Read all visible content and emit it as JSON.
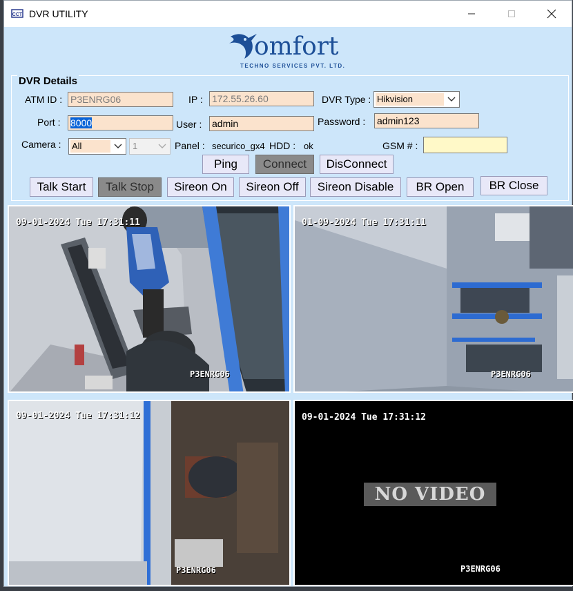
{
  "window": {
    "title": "DVR UTILITY"
  },
  "logo": {
    "word": "omfort",
    "subtitle": "TECHNO SERVICES PVT. LTD."
  },
  "details": {
    "title": "DVR Details",
    "atm_id": {
      "label": "ATM ID :",
      "value": "P3ENRG06"
    },
    "ip": {
      "label": "IP :",
      "value": "172.55.26.60"
    },
    "dvr_type": {
      "label": "DVR Type :",
      "value": "Hikvision"
    },
    "port": {
      "label": "Port :",
      "value": "8000"
    },
    "user": {
      "label": "User :",
      "value": "admin"
    },
    "password": {
      "label": "Password :",
      "value": "admin123"
    },
    "camera": {
      "label": "Camera :",
      "value": "All",
      "channel": "1"
    },
    "panel": {
      "label": "Panel :",
      "value": "securico_gx4"
    },
    "hdd": {
      "label": "HDD :",
      "value": "ok"
    },
    "gsm": {
      "label": "GSM # :",
      "value": ""
    }
  },
  "buttons": {
    "ping": "Ping",
    "connect": "Connect",
    "disconnect": "DisConnect",
    "talk_start": "Talk Start",
    "talk_stop": "Talk Stop",
    "sireon_on": "Sireon On",
    "sireon_off": "Sireon Off",
    "sireon_disable": "Sireon Disable",
    "br_open": "BR Open",
    "br_close": "BR Close"
  },
  "cameras": [
    {
      "timestamp": "09-01-2024 Tue 17:31:11",
      "label": "P3ENRG06"
    },
    {
      "timestamp": "01-09-2024 Tue 17:31:11",
      "label": "P3ENRG06"
    },
    {
      "timestamp": "09-01-2024 Tue 17:31:12",
      "label": "P3ENRG06"
    },
    {
      "timestamp": "09-01-2024 Tue 17:31:12",
      "label": "P3ENRG06",
      "overlay": "NO VIDEO"
    }
  ],
  "colors": {
    "form_bg": "#cde6fa",
    "field_bg": "#fbe3cd",
    "brand": "#1d4f97"
  }
}
